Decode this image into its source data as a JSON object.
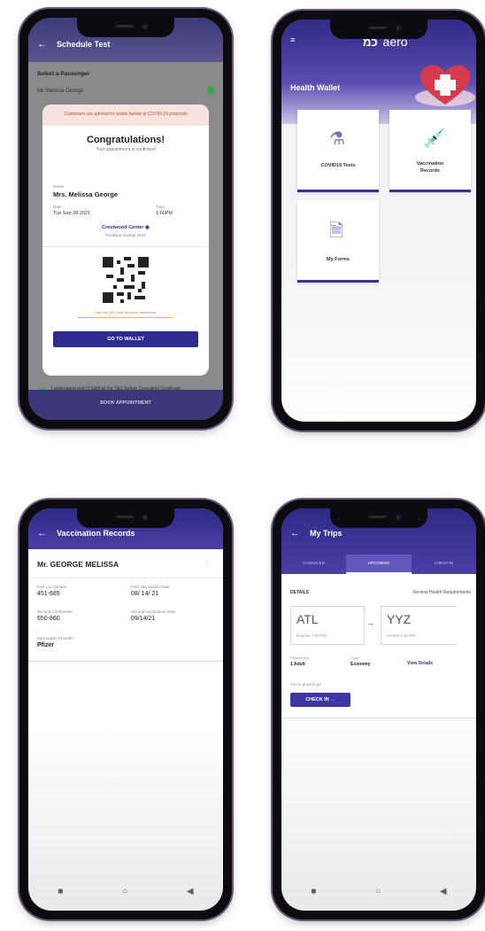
{
  "screen1": {
    "title": "Schedule Test",
    "section_label": "Select a Passenger",
    "passenger_preview": "Mr. Melissa George",
    "modal": {
      "notice": "Customers are advised to reside before at COVID-19 protocols",
      "heading": "Congratulations!",
      "subheading": "Your appointment is confirmed",
      "name_label": "Name",
      "name_value": "Mrs. Melissa George",
      "date_label": "Date",
      "date_value": "Tue Sep 28 2021",
      "time_label": "Time",
      "time_value": "1:00PM",
      "location_name": "Crestwood Center",
      "location_addr": "Fictitious Avenue 1613",
      "qr_caption": "Use this QR Code for future references",
      "wallet_button": "GO TO WALLET"
    },
    "consent_text": "I understand and I'll fulfill all the T&C Before Consulting Certificate",
    "book_button": "BOOK APPOINTMENT"
  },
  "screen2": {
    "brand": "aero",
    "header_title": "Health Wallet",
    "cards": [
      {
        "label": "COVID19 Tests"
      },
      {
        "label": "Vaccination Records"
      },
      {
        "label": "My Forms"
      }
    ],
    "colors": {
      "accent": "#3b2f96",
      "heart": "#d63a4c"
    }
  },
  "screen3": {
    "title": "Vaccination Records",
    "patient": "Mr. GEORGE MELISSA",
    "fields": [
      {
        "label": "First Lot Number",
        "value": "451-685"
      },
      {
        "label": "First Vaccination Date",
        "value": "08/ 14/ 21"
      },
      {
        "label": "Second Lot Number",
        "value": "650-860"
      },
      {
        "label": "Second Vaccination Date",
        "value": "09/14/21"
      },
      {
        "label": "Vaccination Provider",
        "value": "Pfizer"
      }
    ]
  },
  "screen4": {
    "title": "My Trips",
    "tabs": [
      {
        "label": "CANCELED"
      },
      {
        "label": "UPCOMING"
      },
      {
        "label": "CHECK-IN"
      }
    ],
    "trip_label": "DETAILS",
    "requirements_link": "Review Health Requirements",
    "origin": {
      "code": "ATL",
      "time": "Departs 7:50 PM"
    },
    "destination": {
      "code": "YYZ",
      "time": "Arrives 6:10 PM"
    },
    "passengers_label": "Passengers",
    "passengers_value": "1 Adult",
    "class_label": "Class",
    "class_value": "Economy",
    "details_link": "View Details",
    "status_text": "You're good to go",
    "checkin_button": "CHECK IN"
  }
}
